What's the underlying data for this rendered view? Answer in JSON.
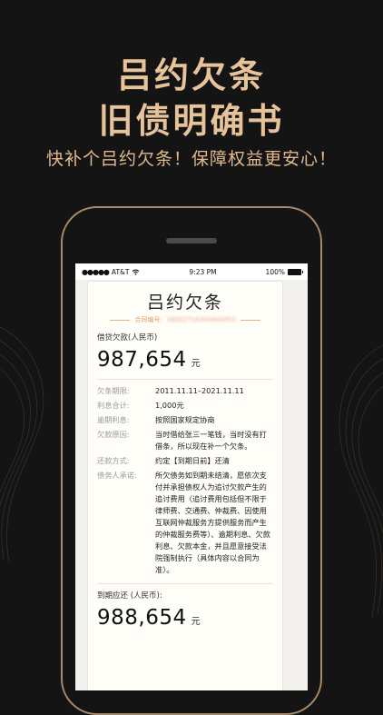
{
  "promo": {
    "title_line1": "吕约欠条",
    "title_line2": "旧债明确书",
    "subtitle": "快补个吕约欠条！保障权益更安心！"
  },
  "status_bar": {
    "carrier": "AT&T",
    "time": "9:23 PM",
    "battery": "100%"
  },
  "document": {
    "title": "吕约欠条",
    "contract_label": "合同编号:",
    "contract_number": "16052714345400053",
    "loan_label": "借贷欠款(人民币)",
    "loan_amount": "987,654",
    "currency_unit": "元",
    "rows": [
      {
        "key": "欠条期限:",
        "value": "2011.11.11–2021.11.11"
      },
      {
        "key": "利息合计:",
        "value": "1,000元"
      },
      {
        "key": "逾期利息:",
        "value": "按照国家规定协商"
      },
      {
        "key": "欠款原因:",
        "value": "当时借给张三一笔钱，当时没有打借条，所以现在补一个欠条。"
      },
      {
        "key": "还款方式:",
        "value": "约定【到期日前】还清"
      },
      {
        "key": "债务人承诺:",
        "value": "所欠债务如到期未结清，愿依次支付并承担债权人为追讨欠款产生的追讨费用（追讨费用包括但不限于律师费、交通费、仲裁费、因使用互联网仲裁服务方提供服务而产生的仲裁服务费等）、逾期利息、欠款利息、欠款本金，并且愿意接受法院强制执行（具体内容以合同为准）。"
      }
    ],
    "due_label": "到期应还 (人民币):",
    "due_amount": "988,654",
    "due_unit": "元"
  },
  "colors": {
    "background": "#141414",
    "gold": "#e7c39a",
    "phone_frame": "#a88a6a",
    "contract_accent": "#e0a06a"
  }
}
